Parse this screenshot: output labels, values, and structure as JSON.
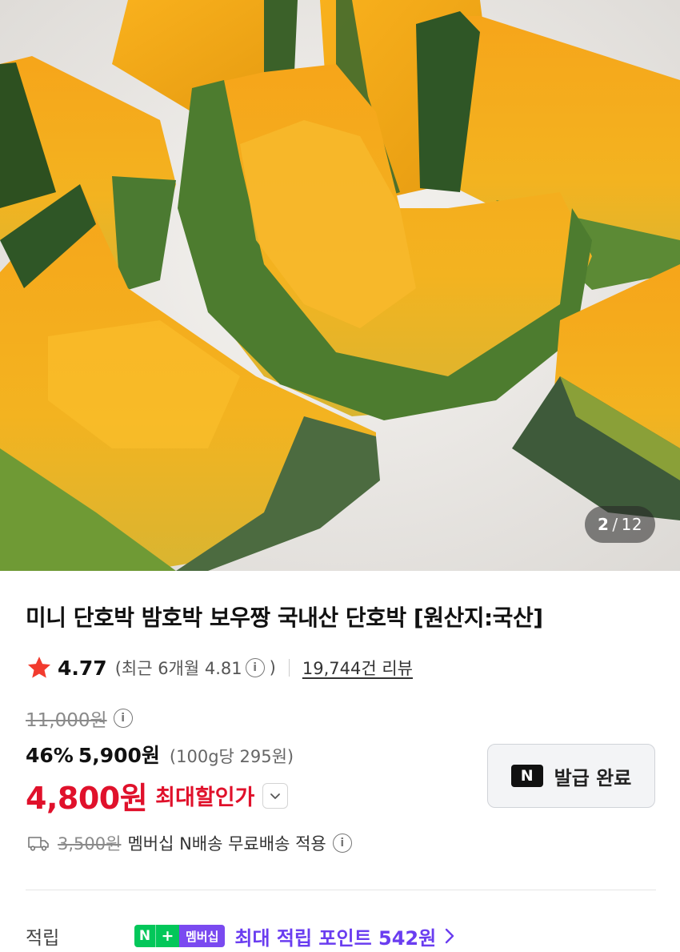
{
  "image": {
    "alt": "",
    "counter_current": "2",
    "counter_sep": "/",
    "counter_total": "12"
  },
  "product": {
    "title": "미니 단호박 밤호박 보우짱 국내산 단호박 [원산지:국산]",
    "rating": "4.77",
    "rating_recent_open": "(최근 6개월 4.81",
    "rating_recent_close": ")",
    "review_count": "19,744건 리뷰",
    "original_price": "11,000원",
    "discount_rate": "46%",
    "sale_price": "5,900원",
    "unit_price": "(100g당 295원)",
    "max_price": "4,800원",
    "max_label": "최대할인가"
  },
  "coupon": {
    "badge": "N",
    "label": "발급 완료"
  },
  "shipping": {
    "old_fee": "3,500원",
    "text": "멤버십 N배송 무료배송 적용"
  },
  "points": {
    "label": "적립",
    "badge_n": "N",
    "badge_plus": "+",
    "badge_member": "멤버십",
    "text": "최대 적립 포인트 542원"
  },
  "colors": {
    "accent_red": "#e0112b",
    "naver_green": "#03c75a",
    "member_purple": "#6a3df0"
  },
  "icons": [
    "star-icon",
    "info-icon",
    "chevron-down-icon",
    "truck-icon",
    "chevron-right-icon"
  ]
}
